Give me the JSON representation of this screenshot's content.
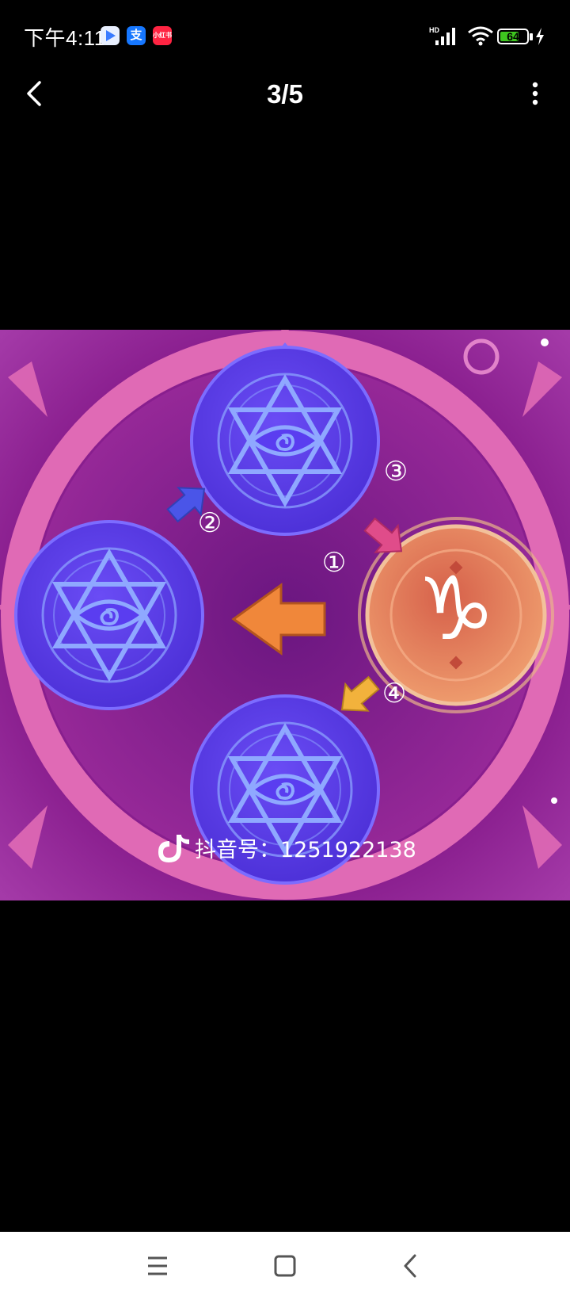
{
  "status_bar": {
    "time": "下午4:11",
    "apps": [
      {
        "icon": "play-store-icon",
        "label": "▶",
        "color": "#e9f0ff"
      },
      {
        "icon": "alipay-icon",
        "label": "支",
        "color": "#1677ff"
      },
      {
        "icon": "xiaohongshu-icon",
        "label": "小红书",
        "color": "#ff2442"
      }
    ],
    "network": "HD",
    "battery": "64"
  },
  "header": {
    "page_counter": "3/5"
  },
  "image": {
    "watermark": "抖音号：1251922138",
    "step_labels": [
      "①",
      "②",
      "③",
      "④"
    ],
    "capricorn_symbol": "♑",
    "colors": {
      "background": "#8a1f8f",
      "ring": "#e06ab5",
      "blue_tile": "#5a3df0",
      "orange_tile": "#e98a5f",
      "arrow_orange": "#f0873a",
      "arrow_blue": "#4a55e8",
      "arrow_pink": "#e04c8a",
      "arrow_yellow": "#f2b23c"
    }
  },
  "nav_bar": {
    "buttons": [
      "menu-icon",
      "home-icon",
      "back-icon"
    ]
  }
}
